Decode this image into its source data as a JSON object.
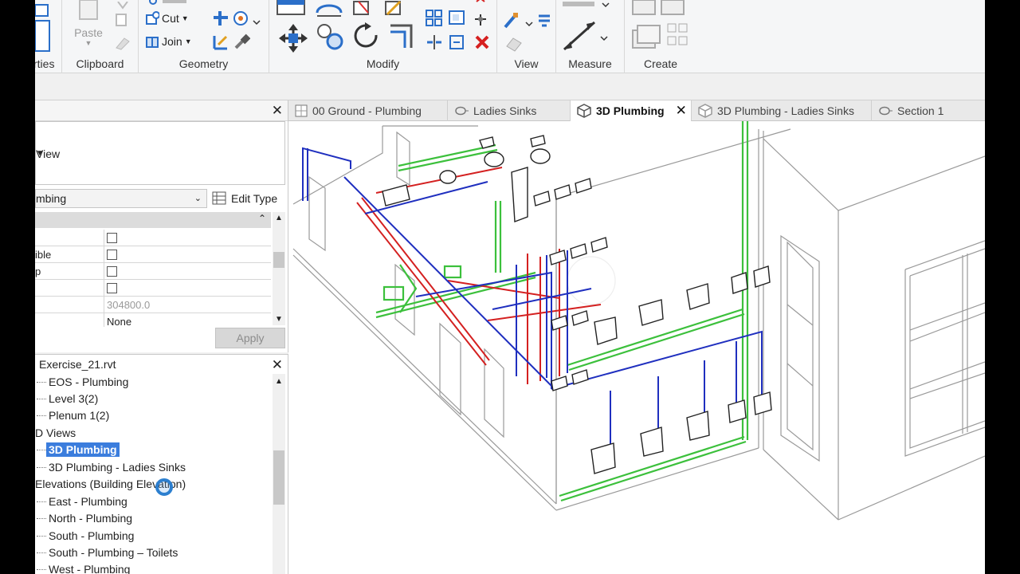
{
  "ribbon": {
    "properties_label": "rties",
    "clipboard": {
      "paste": "Paste",
      "label": "Clipboard"
    },
    "geometry": {
      "cut": "Cut",
      "join": "Join",
      "label": "Geometry"
    },
    "modify": {
      "label": "Modify"
    },
    "view": {
      "label": "View"
    },
    "measure": {
      "label": "Measure"
    },
    "create": {
      "label": "Create"
    }
  },
  "properties": {
    "type_name": "View",
    "filter_value": "mbing",
    "edit_type": "Edit Type",
    "rows": [
      {
        "key": "",
        "value": ""
      },
      {
        "key": "ible",
        "value": ""
      },
      {
        "key": "p",
        "value": ""
      },
      {
        "key": "",
        "value": ""
      },
      {
        "key": "",
        "value": "304800.0"
      },
      {
        "key": "",
        "value": "None"
      }
    ],
    "apply": "Apply"
  },
  "browser": {
    "title": "Exercise_21.rvt",
    "items": [
      "EOS - Plumbing",
      "Level 3(2)",
      "Plenum 1(2)",
      "D Views",
      "3D Plumbing",
      "3D Plumbing - Ladies Sinks",
      "Elevations (Building Elevation)",
      "East - Plumbing",
      "North - Plumbing",
      "South - Plumbing",
      "South - Plumbing – Toilets",
      "West - Plumbing"
    ]
  },
  "tabs": [
    {
      "label": "00 Ground - Plumbing"
    },
    {
      "label": "Ladies Sinks"
    },
    {
      "label": "3D Plumbing"
    },
    {
      "label": "3D Plumbing - Ladies Sinks"
    },
    {
      "label": "Section 1"
    }
  ],
  "colors": {
    "accent": "#3b7ddd",
    "pipe_blue": "#1f2fbf",
    "pipe_red": "#d42020",
    "pipe_green": "#3cc03c"
  }
}
